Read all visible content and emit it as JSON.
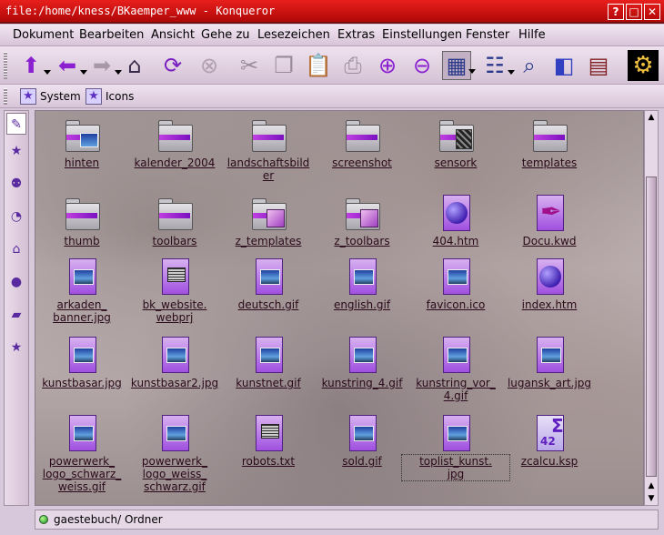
{
  "window": {
    "title": "file:/home/kness/BKaemper_www - Konqueror",
    "buttons": [
      "?",
      "□",
      "✕"
    ]
  },
  "menu": [
    "Dokument",
    "Bearbeiten",
    "Ansicht",
    "Gehe zu",
    "Lesezeichen",
    "Extras",
    "Einstellungen",
    "Fenster",
    "Hilfe"
  ],
  "bookmarks": {
    "system": "System",
    "icons": "Icons"
  },
  "files": [
    {
      "name": "hinten",
      "icon": "folder-image"
    },
    {
      "name": "kalender_2004",
      "icon": "folder"
    },
    {
      "name": "landschaftsbild\ner",
      "icon": "folder"
    },
    {
      "name": "screenshot",
      "icon": "folder"
    },
    {
      "name": "sensork",
      "icon": "folder-film"
    },
    {
      "name": "templates",
      "icon": "folder"
    },
    {
      "name": "thumb",
      "icon": "folder"
    },
    {
      "name": "toolbars",
      "icon": "folder"
    },
    {
      "name": "z_templates",
      "icon": "folder-package"
    },
    {
      "name": "z_toolbars",
      "icon": "folder-package"
    },
    {
      "name": "404.htm",
      "icon": "globe"
    },
    {
      "name": "Docu.kwd",
      "icon": "quill"
    },
    {
      "name": "arkaden_\nbanner.jpg",
      "icon": "image"
    },
    {
      "name": "bk_website.\nwebprj",
      "icon": "document"
    },
    {
      "name": "deutsch.gif",
      "icon": "image"
    },
    {
      "name": "english.gif",
      "icon": "image"
    },
    {
      "name": "favicon.ico",
      "icon": "image"
    },
    {
      "name": "index.htm",
      "icon": "globe"
    },
    {
      "name": "kunstbasar.jpg",
      "icon": "image"
    },
    {
      "name": "kunstbasar2.jpg",
      "icon": "image"
    },
    {
      "name": "kunstnet.gif",
      "icon": "image"
    },
    {
      "name": "kunstring_4.gif",
      "icon": "image"
    },
    {
      "name": "kunstring_vor_\n4.gif",
      "icon": "image"
    },
    {
      "name": "lugansk_art.jpg",
      "icon": "image"
    },
    {
      "name": "powerwerk_\nlogo_schwarz_\nweiss.gif",
      "icon": "image"
    },
    {
      "name": "powerwerk_\nlogo_weiss_\nschwarz.gif",
      "icon": "image"
    },
    {
      "name": "robots.txt",
      "icon": "document"
    },
    {
      "name": "sold.gif",
      "icon": "image"
    },
    {
      "name": "toplist_kunst.\njpg",
      "icon": "image"
    },
    {
      "name": "zcalcu.ksp",
      "icon": "calculator"
    }
  ],
  "status": {
    "text": "gaestebuch/  Ordner"
  },
  "colors": {
    "titlebar": "#d01010",
    "accent": "#a040e0",
    "chrome": "#e0d0e0"
  }
}
